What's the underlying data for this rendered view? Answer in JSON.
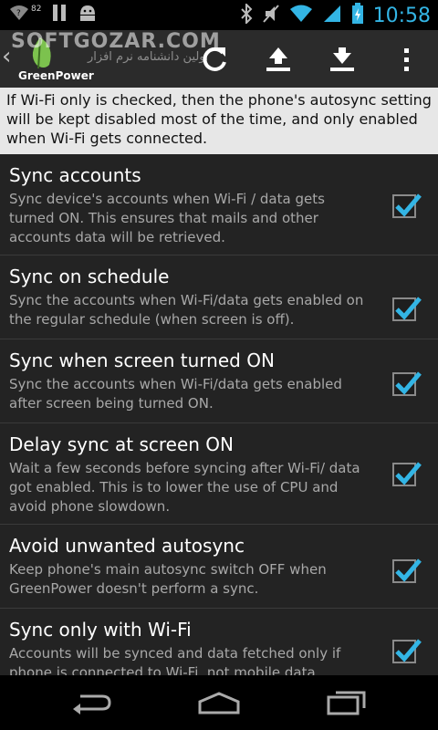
{
  "status_bar": {
    "notification_count": "82",
    "time": "10:58"
  },
  "action_bar": {
    "watermark": "SOFTGOZAR.COM",
    "watermark_sub": "اولین دانشنامه نرم افزار",
    "app_name": "GreenPower",
    "icons": [
      "back-chevron-icon",
      "refresh-icon",
      "upload-icon",
      "download-icon",
      "overflow-menu-icon"
    ]
  },
  "info_text": "If Wi-Fi only is checked, then the phone's autosync setting will be kept disabled most of the time, and only enabled when Wi-Fi gets connected.",
  "settings": [
    {
      "title": "Sync accounts",
      "summary": "Sync device's accounts when Wi-Fi / data gets turned ON. This ensures that mails and other accounts data will be retrieved.",
      "checked": true
    },
    {
      "title": "Sync on schedule",
      "summary": "Sync the accounts when Wi-Fi/data gets enabled on the regular schedule (when screen is off).",
      "checked": true
    },
    {
      "title": "Sync when screen turned ON",
      "summary": "Sync the accounts when Wi-Fi/data gets enabled after screen being turned ON.",
      "checked": true
    },
    {
      "title": "Delay sync at screen ON",
      "summary": "Wait a few seconds before syncing after Wi-Fi/ data got enabled. This is to lower the use of CPU and avoid phone slowdown.",
      "checked": true
    },
    {
      "title": "Avoid unwanted autosync",
      "summary": "Keep phone's main autosync switch OFF when GreenPower doesn't perform a sync.",
      "checked": true
    },
    {
      "title": "Sync only with Wi-Fi",
      "summary": "Accounts will be synced and data fetched only if phone is connected to Wi-Fi, not mobile data.",
      "checked": true
    }
  ],
  "colors": {
    "accent": "#33b5e5",
    "info_bg": "#e7e7e7",
    "list_bg": "#232323",
    "action_bar_bg": "#2b2b2b"
  }
}
